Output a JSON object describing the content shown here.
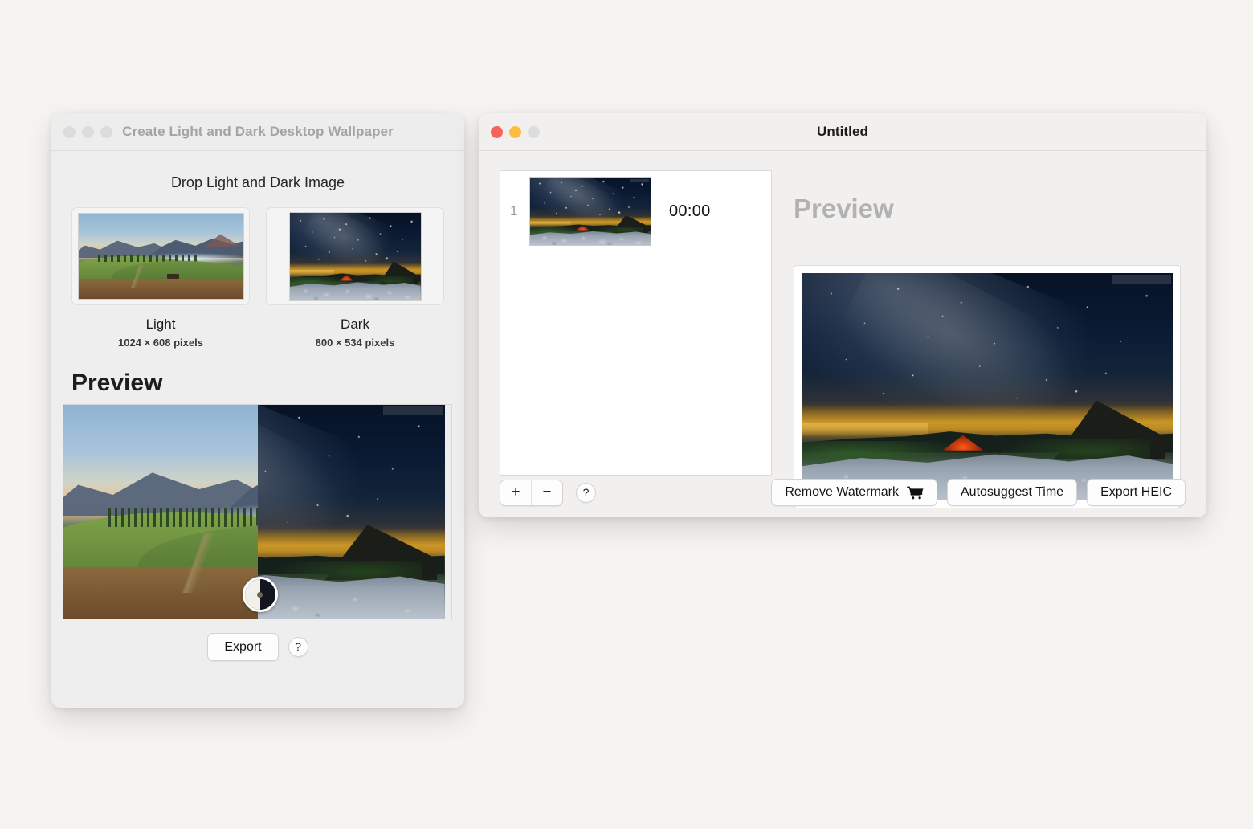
{
  "desktop": {
    "background": "#f6f4f0"
  },
  "left_window": {
    "title": "Create Light and Dark Desktop Wallpaper",
    "active": false,
    "traffic_lights": [
      {
        "name": "close-button",
        "color": "#dcdcdc"
      },
      {
        "name": "minimize-button",
        "color": "#dcdcdc"
      },
      {
        "name": "zoom-button",
        "color": "#dcdcdc"
      }
    ],
    "drop_heading": "Drop Light and Dark Image",
    "wells": [
      {
        "caption": "Light",
        "dimensions": "1024 × 608 pixels",
        "image": "day-mountain-meadow-photo"
      },
      {
        "caption": "Dark",
        "dimensions": "800 × 534 pixels",
        "image": "night-sky-tent-photo"
      }
    ],
    "preview_heading": "Preview",
    "split_preview": {
      "left_image": "day-mountain-meadow-photo",
      "right_image": "night-sky-tent-photo",
      "handle": "split-compare-handle",
      "split_percent": 50
    },
    "export_button": "Export",
    "help_button": "?"
  },
  "right_window": {
    "title": "Untitled",
    "active": true,
    "traffic_lights": [
      {
        "name": "close-button",
        "color": "#f4645a"
      },
      {
        "name": "minimize-button",
        "color": "#fbbe3f"
      },
      {
        "name": "zoom-button",
        "color": "#dddddd"
      }
    ],
    "list": {
      "rows": [
        {
          "index": "1",
          "thumbnail": "night-sky-tent-photo",
          "time": "00:00"
        }
      ]
    },
    "preview_heading": "Preview",
    "preview_image": "night-sky-tent-photo",
    "toolbar": {
      "add_label": "+",
      "remove_label": "−",
      "help_label": "?",
      "remove_watermark_label": "Remove Watermark",
      "remove_watermark_icon": "shopping-cart-icon",
      "autosuggest_time_label": "Autosuggest Time",
      "export_heic_label": "Export HEIC"
    }
  }
}
